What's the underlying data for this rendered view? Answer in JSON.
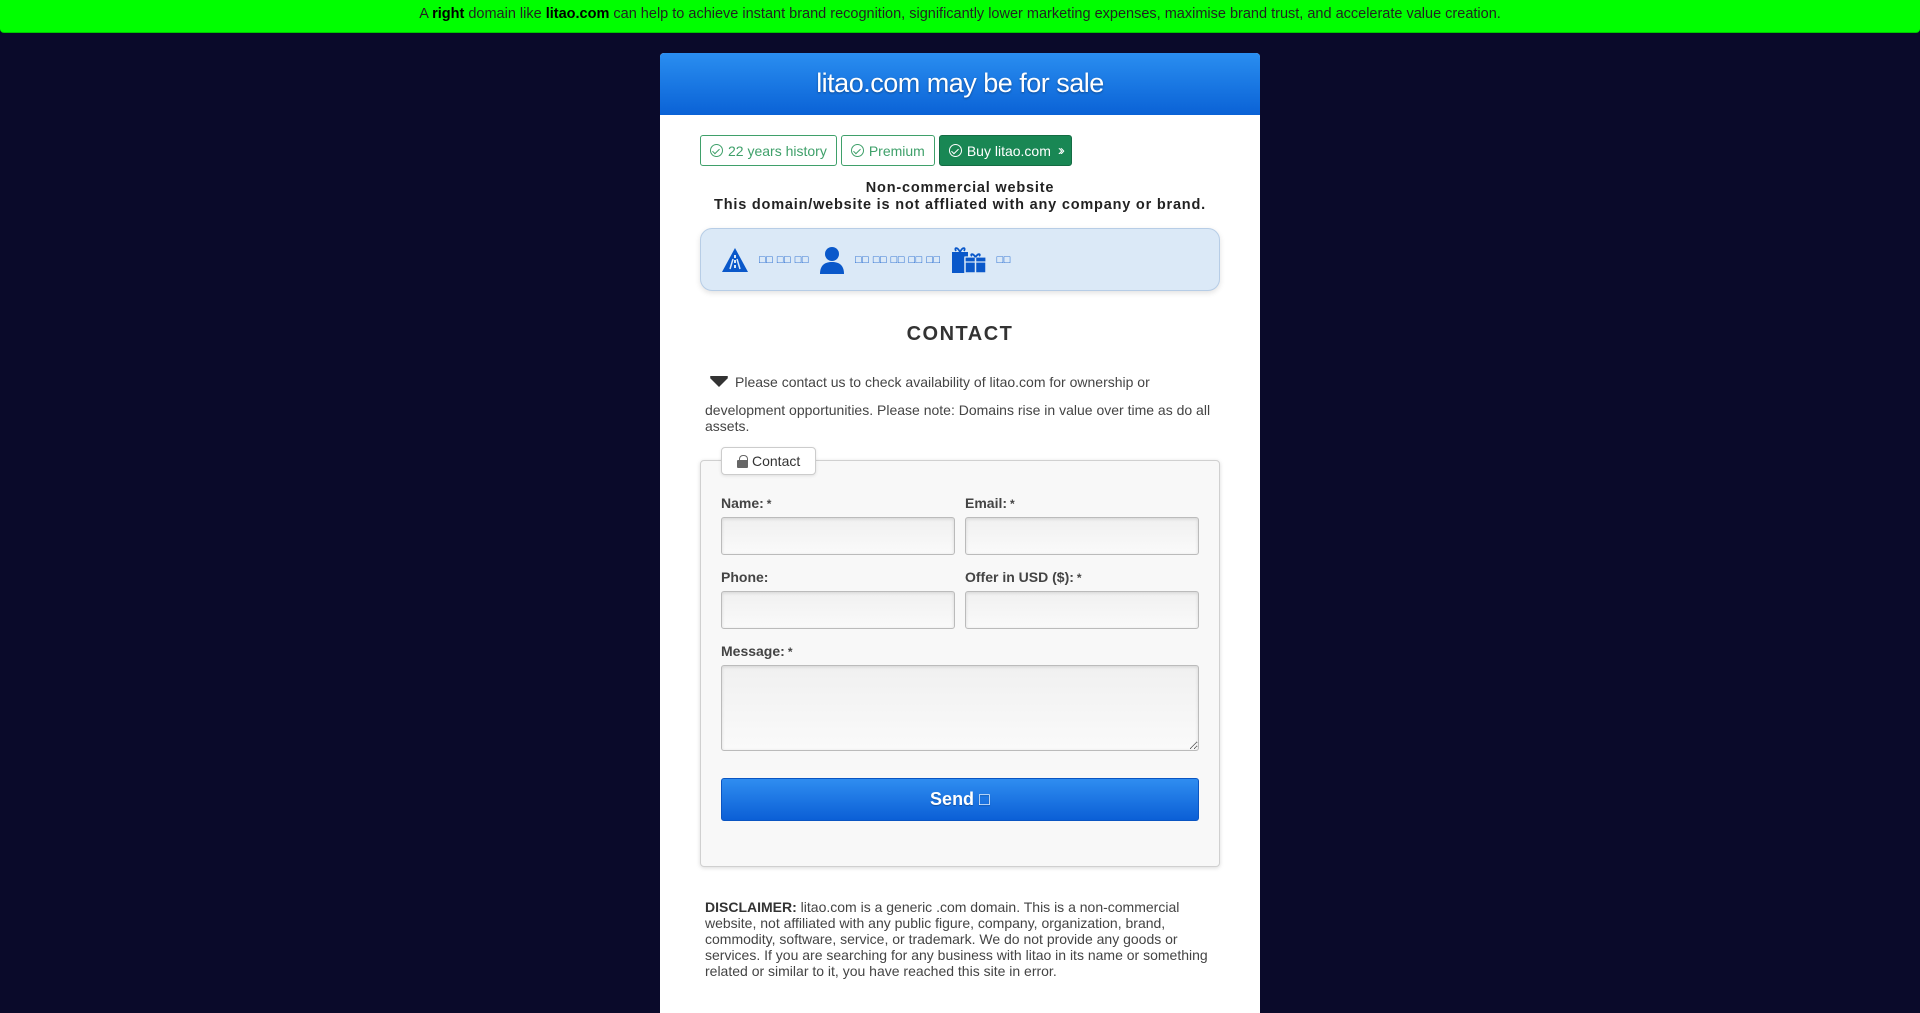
{
  "topbar": {
    "pre": "A ",
    "right": "right",
    "mid": " domain like ",
    "domain": "litao.com",
    "post": " can help to achieve instant brand recognition, significantly lower marketing expenses, maximise brand trust, and accelerate value creation."
  },
  "header": {
    "title": "litao.com may be for sale"
  },
  "badges": {
    "history": "22 years history",
    "premium": "Premium",
    "buy": "Buy litao.com"
  },
  "noncommercial": {
    "line1": "Non-commercial website",
    "line2": "This domain/website is not affliated with any company or brand."
  },
  "info": {
    "item1": "□□ □□ □□",
    "item2": "□□ □□ □□ □□ □□",
    "item3": "□□"
  },
  "contact": {
    "title": "CONTACT",
    "intro1": "Please contact us to check availability of litao.com for ownership or",
    "intro2": "development opportunities. Please note: Domains rise in value over time as do all assets."
  },
  "form": {
    "legend": "Contact",
    "name_label": "Name:",
    "email_label": "Email:",
    "phone_label": "Phone:",
    "offer_label": "Offer in USD ($):",
    "message_label": "Message:",
    "required_mark": "*",
    "send_label": "Send □"
  },
  "disclaimer": {
    "label": "DISCLAIMER:",
    "text": " litao.com is a generic .com domain. This is a non-commercial website, not affiliated with any public figure, company, organization, brand, commodity, software, service, or trademark. We do not provide any goods or services. If you are searching for any business with litao in its name or something related or similar to it, you have reached this site in error."
  },
  "colors": {
    "topbar": "#00ff00",
    "page_bg": "#0a0a2a",
    "header_blue": "#1a78e8",
    "badge_green": "#3fa06a",
    "buy_green": "#198754",
    "info_bg": "#dbe9f7",
    "icon_blue": "#0a58ca"
  }
}
